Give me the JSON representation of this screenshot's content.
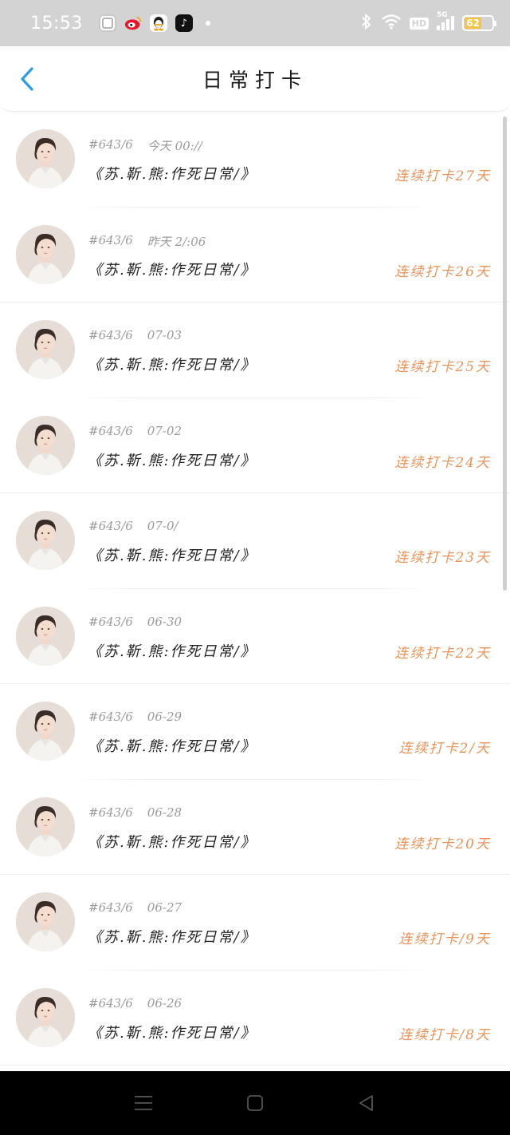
{
  "status_bar": {
    "time": "15:53",
    "apps": [
      "k-app-icon",
      "weibo-icon",
      "qq-icon",
      "tiktok-icon"
    ],
    "hd_label": "HD",
    "network_label": "5G",
    "battery_level": 62,
    "battery_text": "62",
    "battery_color": "#f4c542"
  },
  "header": {
    "title": "日常打卡",
    "back_icon": "chevron-left-icon",
    "accent_color": "#2e9be8"
  },
  "list": {
    "streak_color": "#e8945a",
    "items": [
      {
        "user": "#643/6",
        "time": "今天 00://",
        "content": "《苏.靳.熊:作死日常/》",
        "streak": "连续打卡27天"
      },
      {
        "user": "#643/6",
        "time": "昨天 2/:06",
        "content": "《苏.靳.熊:作死日常/》",
        "streak": "连续打卡26天"
      },
      {
        "user": "#643/6",
        "time": "07-03",
        "content": "《苏.靳.熊:作死日常/》",
        "streak": "连续打卡25天"
      },
      {
        "user": "#643/6",
        "time": "07-02",
        "content": "《苏.靳.熊:作死日常/》",
        "streak": "连续打卡24天"
      },
      {
        "user": "#643/6",
        "time": "07-0/",
        "content": "《苏.靳.熊:作死日常/》",
        "streak": "连续打卡23天"
      },
      {
        "user": "#643/6",
        "time": "06-30",
        "content": "《苏.靳.熊:作死日常/》",
        "streak": "连续打卡22天"
      },
      {
        "user": "#643/6",
        "time": "06-29",
        "content": "《苏.靳.熊:作死日常/》",
        "streak": "连续打卡2/天"
      },
      {
        "user": "#643/6",
        "time": "06-28",
        "content": "《苏.靳.熊:作死日常/》",
        "streak": "连续打卡20天"
      },
      {
        "user": "#643/6",
        "time": "06-27",
        "content": "《苏.靳.熊:作死日常/》",
        "streak": "连续打卡/9天"
      },
      {
        "user": "#643/6",
        "time": "06-26",
        "content": "《苏.靳.熊:作死日常/》",
        "streak": "连续打卡/8天"
      }
    ]
  },
  "nav_bar": {
    "buttons": [
      "menu-icon",
      "home-icon",
      "back-triangle-icon"
    ]
  }
}
